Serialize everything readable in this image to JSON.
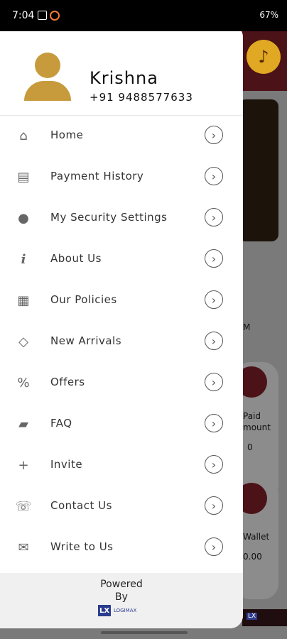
{
  "status_bar": {
    "time": "7:04",
    "right": "67%"
  },
  "profile": {
    "name": "Krishna",
    "phone": "+91 9488577633"
  },
  "menu": [
    {
      "label": "Home",
      "icon": "home-icon",
      "glyph": "⌂"
    },
    {
      "label": "Payment History",
      "icon": "receipt-icon",
      "glyph": "▤"
    },
    {
      "label": "My Security Settings",
      "icon": "security-user-icon",
      "glyph": "●"
    },
    {
      "label": "About Us",
      "icon": "info-icon",
      "glyph": "i"
    },
    {
      "label": "Our Policies",
      "icon": "clipboard-icon",
      "glyph": "▦"
    },
    {
      "label": "New Arrivals",
      "icon": "diamond-icon",
      "glyph": "◇"
    },
    {
      "label": "Offers",
      "icon": "percent-badge-icon",
      "glyph": "%"
    },
    {
      "label": "FAQ",
      "icon": "faq-chat-icon",
      "glyph": "▰"
    },
    {
      "label": "Invite",
      "icon": "add-user-icon",
      "glyph": "+"
    },
    {
      "label": "Contact Us",
      "icon": "phone-chat-icon",
      "glyph": "☏"
    },
    {
      "label": "Write to Us",
      "icon": "mail-icon",
      "glyph": "✉"
    }
  ],
  "footer": {
    "powered": "Powered",
    "by": "By",
    "logo_mark": "LX",
    "logo_text": "LOGIMAX"
  },
  "background": {
    "m_text": "M",
    "paid": "Paid",
    "amount": "mount",
    "zero": "0",
    "wallet": "Wallet",
    "wallet_val": "0.00"
  }
}
